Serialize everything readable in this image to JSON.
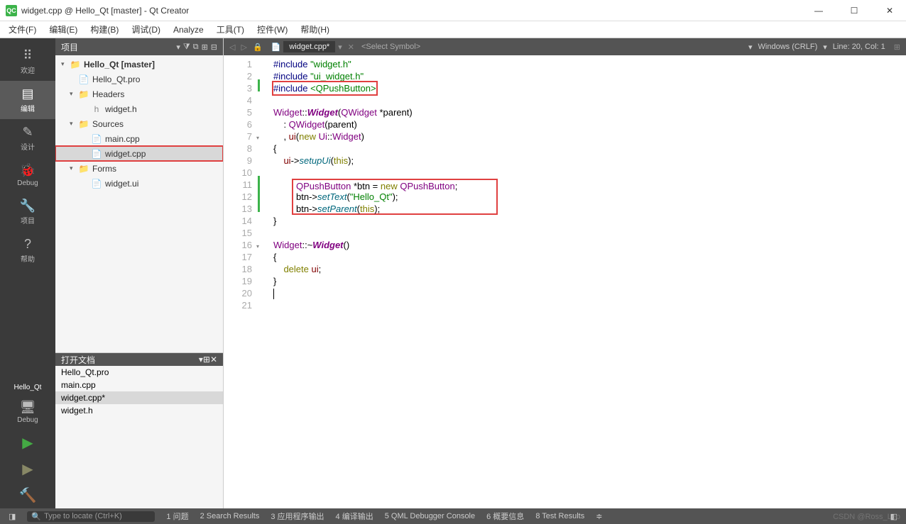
{
  "window": {
    "title": "widget.cpp @ Hello_Qt [master] - Qt Creator",
    "logo_text": "QC",
    "min": "—",
    "max": "☐",
    "close": "✕"
  },
  "menu": [
    "文件(F)",
    "编辑(E)",
    "构建(B)",
    "调试(D)",
    "Analyze",
    "工具(T)",
    "控件(W)",
    "帮助(H)"
  ],
  "leftbar": {
    "items": [
      {
        "icon": "⠿",
        "label": "欢迎"
      },
      {
        "icon": "▤",
        "label": "编辑"
      },
      {
        "icon": "✎",
        "label": "设计"
      },
      {
        "icon": "🐞",
        "label": "Debug"
      },
      {
        "icon": "🔧",
        "label": "项目"
      },
      {
        "icon": "?",
        "label": "帮助"
      }
    ],
    "project": "Hello_Qt",
    "debug": "Debug"
  },
  "project_panel": {
    "title": "项目",
    "tree": [
      {
        "depth": 0,
        "arrow": "▾",
        "icon": "📁",
        "label": "Hello_Qt [master]",
        "bold": true,
        "color": "folder"
      },
      {
        "depth": 1,
        "arrow": "",
        "icon": "📄",
        "label": "Hello_Qt.pro",
        "color": "file"
      },
      {
        "depth": 1,
        "arrow": "▾",
        "icon": "📁",
        "label": "Headers",
        "color": "folder"
      },
      {
        "depth": 2,
        "arrow": "",
        "icon": "h",
        "label": "widget.h",
        "color": "file"
      },
      {
        "depth": 1,
        "arrow": "▾",
        "icon": "📁",
        "label": "Sources",
        "color": "folder"
      },
      {
        "depth": 2,
        "arrow": "",
        "icon": "📄",
        "label": "main.cpp",
        "color": "file"
      },
      {
        "depth": 2,
        "arrow": "",
        "icon": "📄",
        "label": "widget.cpp",
        "color": "file",
        "selected": true
      },
      {
        "depth": 1,
        "arrow": "▾",
        "icon": "📁",
        "label": "Forms",
        "color": "folder"
      },
      {
        "depth": 2,
        "arrow": "",
        "icon": "📄",
        "label": "widget.ui",
        "color": "file"
      }
    ]
  },
  "opendocs": {
    "title": "打开文档",
    "items": [
      "Hello_Qt.pro",
      "main.cpp",
      "widget.cpp*",
      "widget.h"
    ],
    "active": 2
  },
  "editor": {
    "filename": "widget.cpp*",
    "symbol": "<Select Symbol>",
    "encoding": "Windows (CRLF)",
    "position": "Line: 20, Col: 1"
  },
  "code": {
    "lines": 21,
    "content": [
      {
        "n": 1,
        "mark": "",
        "html": "<span class='pp'>#include</span> <span class='str'>\"widget.h\"</span>"
      },
      {
        "n": 2,
        "mark": "",
        "html": "<span class='pp'>#include</span> <span class='str'>\"ui_widget.h\"</span>"
      },
      {
        "n": 3,
        "mark": "green",
        "boxed": true,
        "html": "<span class='pp'>#include</span> <span class='str'>&lt;QPushButton&gt;</span>"
      },
      {
        "n": 4,
        "mark": "",
        "html": ""
      },
      {
        "n": 5,
        "mark": "",
        "html": "<span class='type'>Widget</span>::<span class='cls'>Widget</span>(<span class='type'>QWidget</span> *parent)"
      },
      {
        "n": 6,
        "mark": "",
        "html": "    : <span class='type'>QWidget</span>(parent)"
      },
      {
        "n": 7,
        "mark": "",
        "fold": "▾",
        "html": "    , <span class='ptr'>ui</span>(<span class='kw'>new</span> <span class='type'>Ui</span>::<span class='type'>Widget</span>)"
      },
      {
        "n": 8,
        "mark": "",
        "html": "{"
      },
      {
        "n": 9,
        "mark": "",
        "html": "    <span class='ptr'>ui</span>-&gt;<span class='func'>setupUi</span>(<span class='kw'>this</span>);"
      },
      {
        "n": 10,
        "mark": "",
        "html": ""
      },
      {
        "n": 11,
        "mark": "green",
        "boxstart": true,
        "html": "    <span class='type'>QPushButton</span> *btn = <span class='kw'>new</span> <span class='type'>QPushButton</span>;"
      },
      {
        "n": 12,
        "mark": "green",
        "html": "    btn-&gt;<span class='func'>setText</span>(<span class='str'>\"Hello_Qt\"</span>);"
      },
      {
        "n": 13,
        "mark": "green",
        "boxend": true,
        "html": "    btn-&gt;<span class='func'>setParent</span>(<span class='kw'>this</span>);"
      },
      {
        "n": 14,
        "mark": "",
        "html": "}"
      },
      {
        "n": 15,
        "mark": "",
        "html": ""
      },
      {
        "n": 16,
        "mark": "",
        "fold": "▾",
        "html": "<span class='type'>Widget</span>::~<span class='cls'>Widget</span>()"
      },
      {
        "n": 17,
        "mark": "",
        "html": "{"
      },
      {
        "n": 18,
        "mark": "",
        "html": "    <span class='kw'>delete</span> <span class='ptr'>ui</span>;"
      },
      {
        "n": 19,
        "mark": "",
        "html": "}"
      },
      {
        "n": 20,
        "mark": "",
        "html": "<span class='cursor'></span>"
      },
      {
        "n": 21,
        "mark": "",
        "html": ""
      }
    ]
  },
  "statusbar": {
    "search_placeholder": "Type to locate (Ctrl+K)",
    "items": [
      "1 问题",
      "2 Search Results",
      "3 应用程序输出",
      "4 编译输出",
      "5 QML Debugger Console",
      "6 概要信息",
      "8 Test Results"
    ]
  },
  "watermark": "CSDN @Ross_Leo"
}
